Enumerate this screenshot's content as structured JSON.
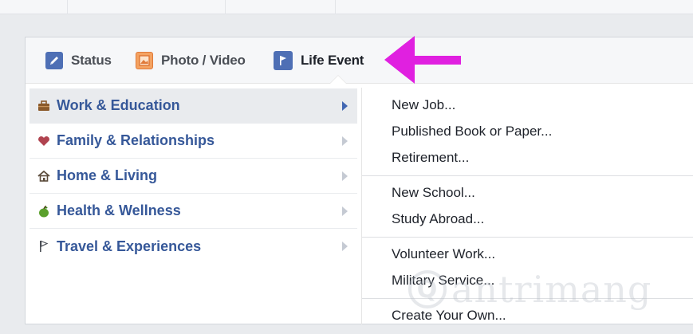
{
  "composer": {
    "tabs": [
      {
        "label": "Status",
        "icon": "pencil-icon",
        "color": "#4267b2"
      },
      {
        "label": "Photo / Video",
        "icon": "photo-icon",
        "color": "#e8874a"
      },
      {
        "label": "Life Event",
        "icon": "flag-icon",
        "color": "#4267b2"
      }
    ]
  },
  "categories": [
    {
      "label": "Work & Education",
      "icon": "briefcase-icon",
      "active": true
    },
    {
      "label": "Family & Relationships",
      "icon": "heart-icon",
      "active": false
    },
    {
      "label": "Home & Living",
      "icon": "house-icon",
      "active": false
    },
    {
      "label": "Health & Wellness",
      "icon": "apple-icon",
      "active": false
    },
    {
      "label": "Travel & Experiences",
      "icon": "flag-icon",
      "active": false
    }
  ],
  "submenu": {
    "groups": [
      [
        "New Job...",
        "Published Book or Paper...",
        "Retirement..."
      ],
      [
        "New School...",
        "Study Abroad..."
      ],
      [
        "Volunteer Work...",
        "Military Service..."
      ],
      [
        "Create Your Own..."
      ]
    ]
  },
  "watermark": {
    "text": "antrimang",
    "logo_letter": "Q"
  },
  "colors": {
    "link_blue": "#365899",
    "annotation_magenta": "#e020e0",
    "active_row_bg": "#e9ebee"
  }
}
